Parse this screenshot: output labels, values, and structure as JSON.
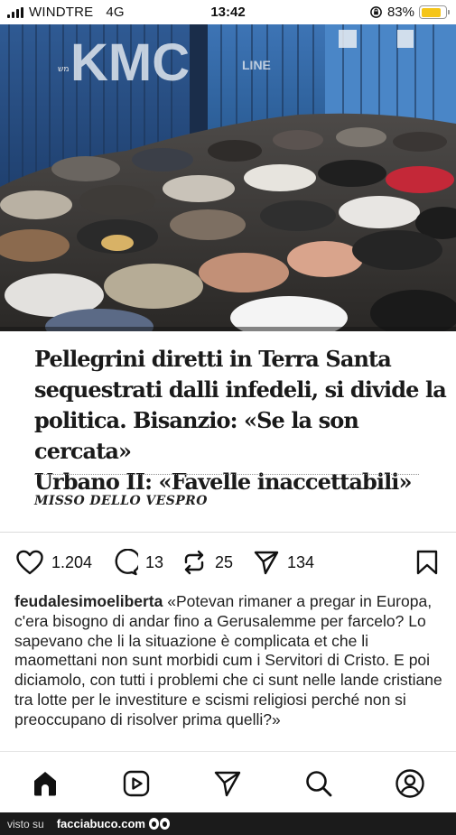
{
  "status_bar": {
    "carrier": "WINDTRE",
    "network": "4G",
    "time": "13:42",
    "battery": "83%",
    "battery_level": 0.83,
    "battery_color": "#f5c518"
  },
  "photo": {
    "sign_text": "KMC",
    "sign_subtext": "LINE",
    "small_label": "מש"
  },
  "article": {
    "headline_lines": [
      "Pellegrini diretti in Terra Santa",
      "sequestrati dalli infedeli, si divide la",
      "politica. Bisanzio: «Se la son cercata»",
      "Urbano II: «Favelle inaccettabili»"
    ],
    "author": "MISSO DELLO VESPRO"
  },
  "actions": {
    "likes": "1.204",
    "comments": "13",
    "reposts": "25",
    "shares": "134",
    "icons": [
      "heart-icon",
      "comment-icon",
      "repost-icon",
      "send-icon",
      "bookmark-icon"
    ]
  },
  "caption": {
    "username": "feudalesimoeliberta",
    "text": "«Potevan rimaner a pregar in Europa, c'era bisogno di andar fino a Gerusalemme per farcelo? Lo sapevano che li la situazione è complicata et che li maomettani non sunt morbidi cum i Servitori di Cristo. E poi diciamolo, con tutti i problemi che ci sunt nelle lande cristiane tra lotte per le investiture e scismi religiosi perché non si preoccupano di risolver prima quelli?»"
  },
  "nav": {
    "items": [
      "home-icon",
      "reels-icon",
      "send-icon",
      "search-icon",
      "profile-icon"
    ]
  },
  "footer": {
    "prefix": "visto su",
    "brand": "facciabuco.com"
  }
}
